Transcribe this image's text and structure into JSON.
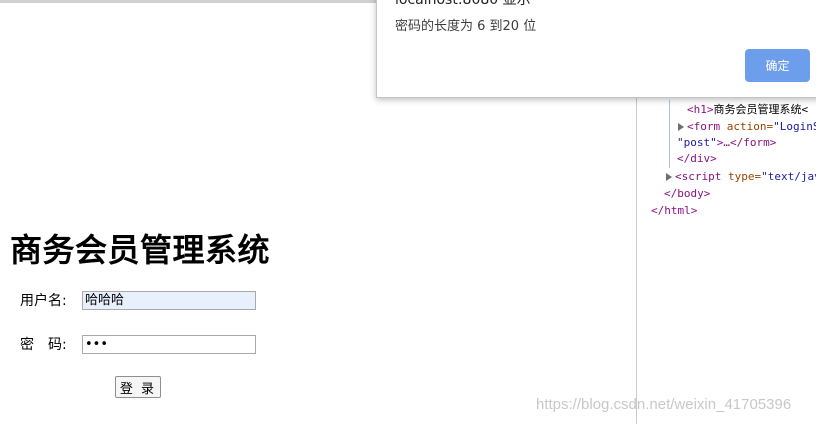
{
  "page": {
    "heading": "商务会员管理系统",
    "username_label": "用户名:",
    "username_value": "哈哈哈",
    "password_label": "密　码:",
    "password_value": "•••",
    "login_button": "登 录"
  },
  "alert": {
    "title": "localhost:8080 显示",
    "message": "密码的长度为 6 到20 位",
    "ok_button": "确定",
    "ok_color": "#6d9eeb"
  },
  "devtools": {
    "lines": [
      {
        "open": "<",
        "tag": "h1",
        "close": ">",
        "text": "商务会员管理系统<"
      },
      {
        "open": "<",
        "tag": "form",
        "attr": " action=",
        "val": "\"LoginS"
      },
      {
        "val": "\"post\"",
        "text": ">…",
        "tag_close": "</form>"
      },
      {
        "tag": "</div>"
      },
      {
        "open": "<",
        "tag": "script",
        "attr": " type=",
        "val": "\"text/jav"
      },
      {
        "tag": "</body>"
      },
      {
        "tag": "</html>"
      }
    ]
  },
  "watermark": "https://blog.csdn.net/weixin_41705396"
}
